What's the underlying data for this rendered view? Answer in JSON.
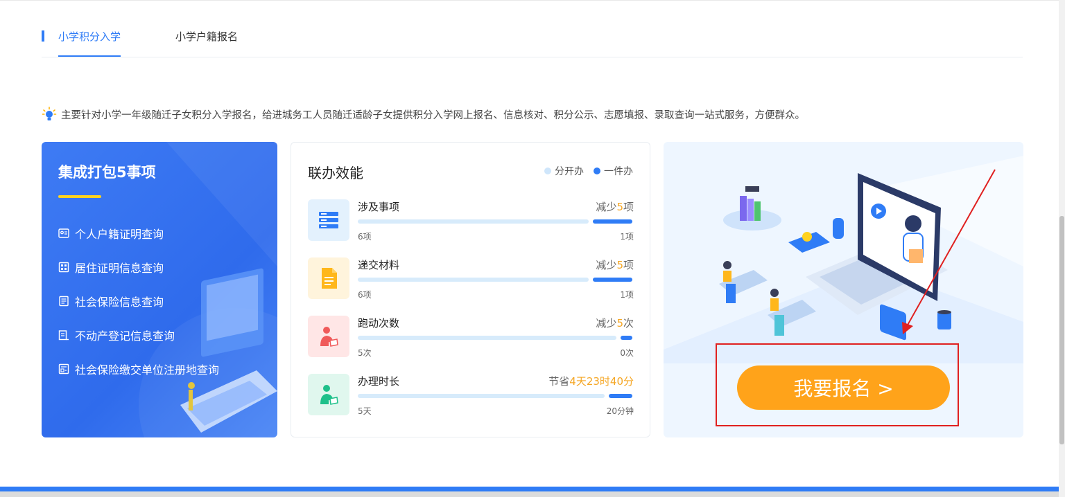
{
  "tabs": [
    {
      "label": "小学积分入学",
      "active": true
    },
    {
      "label": "小学户籍报名",
      "active": false
    }
  ],
  "description": "主要针对小学一年级随迁子女积分入学报名，给进城务工人员随迁适龄子女提供积分入学网上报名、信息核对、积分公示、志愿填报、录取查询一站式服务，方便群众。",
  "integrated": {
    "title": "集成打包5事项",
    "items": [
      {
        "label": "个人户籍证明查询",
        "icon": "id-card-icon"
      },
      {
        "label": "居住证明信息查询",
        "icon": "building-icon"
      },
      {
        "label": "社会保险信息查询",
        "icon": "document-icon"
      },
      {
        "label": "不动产登记信息查询",
        "icon": "house-doc-icon"
      },
      {
        "label": "社会保险缴交单位注册地查询",
        "icon": "register-icon"
      }
    ]
  },
  "efficiency": {
    "title": "联办效能",
    "legend": [
      {
        "label": "分开办",
        "color": "#cfe6fb"
      },
      {
        "label": "一件办",
        "color": "#2f7cf6"
      }
    ],
    "rows": [
      {
        "name": "涉及事项",
        "reduce_prefix": "减少",
        "reduce_value": "5",
        "reduce_suffix": "项",
        "before": "6项",
        "after": "1项",
        "before_fraction": 1.0,
        "after_fraction": 0.167,
        "tile_color": "#e3f1fd",
        "icon": "list-icon"
      },
      {
        "name": "递交材料",
        "reduce_prefix": "减少",
        "reduce_value": "5",
        "reduce_suffix": "项",
        "before": "6项",
        "after": "1项",
        "before_fraction": 1.0,
        "after_fraction": 0.167,
        "tile_color": "#fff4dc",
        "icon": "file-icon"
      },
      {
        "name": "跑动次数",
        "reduce_prefix": "减少",
        "reduce_value": "5",
        "reduce_suffix": "次",
        "before": "5次",
        "after": "0次",
        "before_fraction": 1.0,
        "after_fraction": 0.05,
        "tile_color": "#ffe6e6",
        "icon": "person-icon"
      },
      {
        "name": "办理时长",
        "reduce_prefix": "节省",
        "reduce_value": "4天23时40分",
        "reduce_suffix": "",
        "before": "5天",
        "after": "20分钟",
        "before_fraction": 1.0,
        "after_fraction": 0.1,
        "tile_color": "#e0f7ee",
        "icon": "person-clock-icon"
      }
    ]
  },
  "signup": {
    "label": "我要报名 >"
  },
  "colors": {
    "primary": "#2f7cf6",
    "accent_orange": "#ffa31a",
    "highlight_text": "#f5a623",
    "annotation_red": "#e02020"
  }
}
